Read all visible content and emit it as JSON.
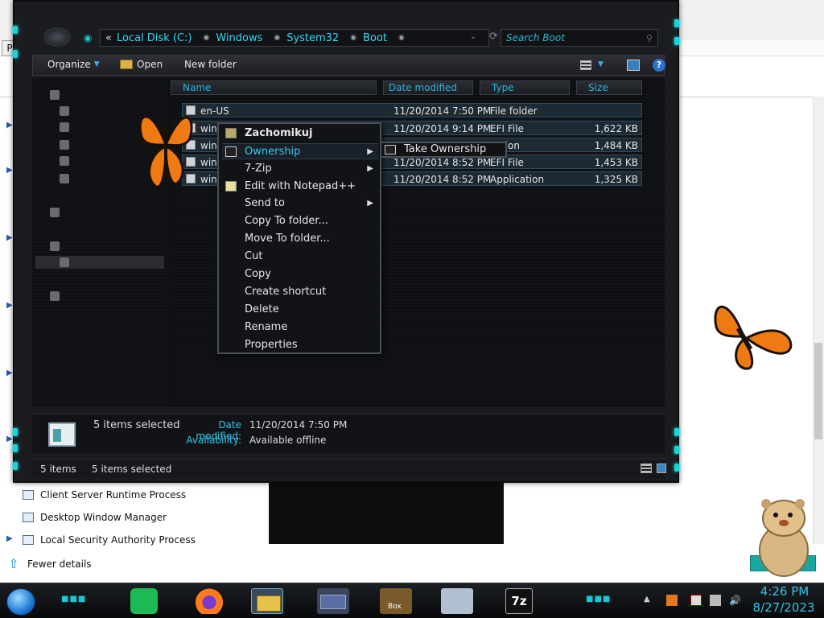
{
  "background_window": {
    "p_tab_label": "P",
    "processes": [
      "Client Server Runtime Process",
      "Desktop Window Manager",
      "Local Security Authority Process"
    ],
    "fewer_details_label": "Fewer details"
  },
  "explorer": {
    "address_prefix": "«",
    "breadcrumbs": [
      "Local Disk (C:)",
      "Windows",
      "System32",
      "Boot"
    ],
    "search_placeholder": "Search Boot",
    "toolbar": {
      "organize_label": "Organize",
      "open_label": "Open",
      "new_folder_label": "New folder"
    },
    "columns": [
      "Name",
      "Date modified",
      "Type",
      "Size"
    ],
    "files": [
      {
        "name": "en-US",
        "date": "11/20/2014 7:50 PM",
        "type": "File folder",
        "size": ""
      },
      {
        "name": "winlo",
        "date": "11/20/2014 9:14 PM",
        "type": "EFI File",
        "size": "1,622 KB"
      },
      {
        "name": "winlo",
        "date": "",
        "type": "cation",
        "size": "1,484 KB"
      },
      {
        "name": "winre",
        "date": "11/20/2014 8:52 PM",
        "type": "EFI File",
        "size": "1,453 KB"
      },
      {
        "name": "winre",
        "date": "11/20/2014 8:52 PM",
        "type": "Application",
        "size": "1,325 KB"
      }
    ],
    "details": {
      "selection": "5 items selected",
      "date_modified_label": "Date modified:",
      "date_modified_value": "11/20/2014 7:50 PM",
      "availability_label": "Availability:",
      "availability_value": "Available offline"
    },
    "status": {
      "items_count": "5 items",
      "selected_count": "5 items selected"
    }
  },
  "context_menu": {
    "items": [
      {
        "label": "Zachomikuj",
        "icon": "hamster-icon"
      },
      {
        "label": "Ownership",
        "icon": "cmd-icon"
      },
      {
        "label": "7-Zip"
      },
      {
        "label": "Edit with Notepad++",
        "icon": "notepad-icon"
      },
      {
        "label": "Send to"
      },
      {
        "label": "Copy To folder..."
      },
      {
        "label": "Move To folder..."
      },
      {
        "label": "Cut"
      },
      {
        "label": "Copy"
      },
      {
        "label": "Create shortcut"
      },
      {
        "label": "Delete"
      },
      {
        "label": "Rename"
      },
      {
        "label": "Properties"
      }
    ],
    "submenu_item": "Take Ownership"
  },
  "taskbar": {
    "seven_zip_label": "7z",
    "box_label": "Box",
    "time": "4:26 PM",
    "date": "8/27/2023"
  },
  "colors": {
    "accent_cyan": "#15d6d6",
    "text_cyan": "#39d5ee",
    "highlight": "#39c6ec"
  }
}
